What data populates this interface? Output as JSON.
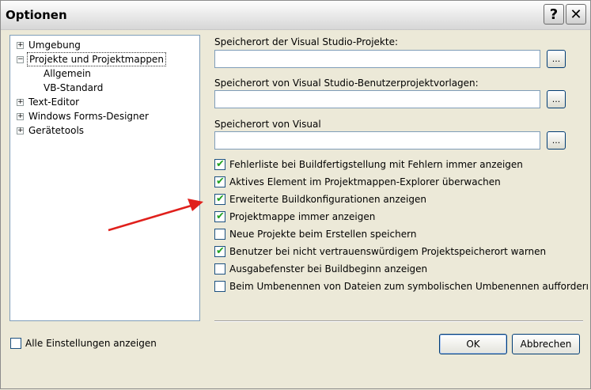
{
  "window": {
    "title": "Optionen"
  },
  "titlebar": {
    "help_icon": "help-icon",
    "close_icon": "close-icon"
  },
  "tree": {
    "items": [
      {
        "label": "Umgebung",
        "expander": "+",
        "level": 0
      },
      {
        "label": "Projekte und Projektmappen",
        "expander": "−",
        "level": 0,
        "selected": true
      },
      {
        "label": "Allgemein",
        "expander": "",
        "level": 1
      },
      {
        "label": "VB-Standard",
        "expander": "",
        "level": 1
      },
      {
        "label": "Text-Editor",
        "expander": "+",
        "level": 0
      },
      {
        "label": "Windows Forms-Designer",
        "expander": "+",
        "level": 0
      },
      {
        "label": "Gerätetools",
        "expander": "+",
        "level": 0
      }
    ]
  },
  "fields": [
    {
      "label": "Speicherort der Visual Studio-Projekte:",
      "value": "",
      "browse": "..."
    },
    {
      "label": "Speicherort von Visual Studio-Benutzerprojektvorlagen:",
      "value": "",
      "browse": "..."
    },
    {
      "label": "Speicherort von Visual",
      "value": "",
      "browse": "..."
    }
  ],
  "checkboxes": [
    {
      "label": "Fehlerliste bei Buildfertigstellung mit Fehlern immer anzeigen",
      "checked": true
    },
    {
      "label": "Aktives Element im Projektmappen-Explorer überwachen",
      "checked": true
    },
    {
      "label": "Erweiterte Buildkonfigurationen anzeigen",
      "checked": true
    },
    {
      "label": "Projektmappe immer anzeigen",
      "checked": true
    },
    {
      "label": "Neue Projekte beim Erstellen speichern",
      "checked": false
    },
    {
      "label": "Benutzer bei nicht vertrauenswürdigem Projektspeicherort warnen",
      "checked": true
    },
    {
      "label": "Ausgabefenster bei Buildbeginn anzeigen",
      "checked": false
    },
    {
      "label": "Beim Umbenennen von Dateien zum symbolischen Umbenennen aufforderı",
      "checked": false
    }
  ],
  "footer": {
    "show_all_label": "Alle Einstellungen anzeigen",
    "show_all_checked": false,
    "ok_label": "OK",
    "cancel_label": "Abbrechen"
  },
  "colors": {
    "check": "#21a121",
    "arrow": "#e0201c",
    "accent": "#003c74"
  }
}
